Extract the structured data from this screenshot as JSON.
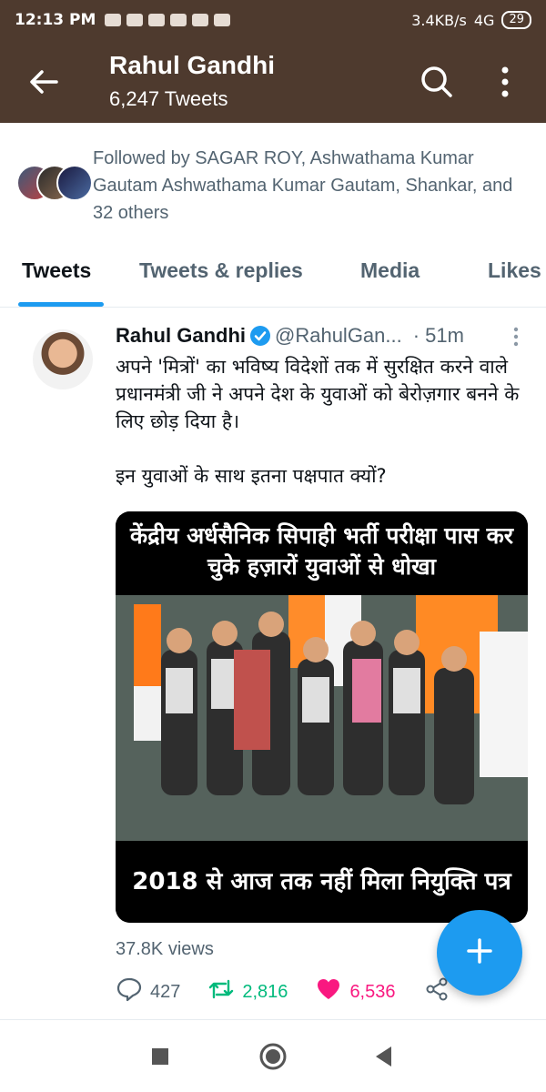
{
  "status_bar": {
    "time": "12:13 PM",
    "network_speed": "3.4KB/s",
    "network_type": "4G",
    "battery": "29"
  },
  "app_bar": {
    "title": "Rahul Gandhi",
    "subtitle": "6,247 Tweets",
    "back_icon": "arrow-left-icon",
    "search_icon": "search-icon",
    "more_icon": "more-vertical-icon"
  },
  "followed_by": {
    "text": "Followed by SAGAR ROY, Ashwathama Kumar Gautam Ashwathama Kumar Gautam, Shankar, and 32 others"
  },
  "tabs": [
    {
      "label": "Tweets",
      "active": true
    },
    {
      "label": "Tweets & replies",
      "active": false
    },
    {
      "label": "Media",
      "active": false
    },
    {
      "label": "Likes",
      "active": false
    }
  ],
  "tweet": {
    "author_name": "Rahul Gandhi",
    "handle": "@RahulGan...",
    "time": "· 51m",
    "body_line1": "अपने 'मित्रों' का भविष्य विदेशों तक में सुरक्षित करने वाले प्रधानमंत्री जी ने अपने देश के युवाओं को बेरोज़गार बनने के लिए छोड़ दिया है।",
    "body_line2": "इन युवाओं के साथ इतना पक्षपात क्यों?",
    "media_headline": "केंद्रीय अर्धसैनिक सिपाही भर्ती परीक्षा पास कर चुके हज़ारों युवाओं से धोखा",
    "media_footer": "2018 से आज तक नहीं मिला नियुक्ति पत्र",
    "views": "37.8K views",
    "replies": "427",
    "retweets": "2,816",
    "likes": "6,536"
  },
  "colors": {
    "app_bar_bg": "#4e3a2e",
    "accent": "#1d9bf0",
    "retweet": "#00ba7c",
    "like": "#f91880",
    "secondary_text": "#536471"
  }
}
